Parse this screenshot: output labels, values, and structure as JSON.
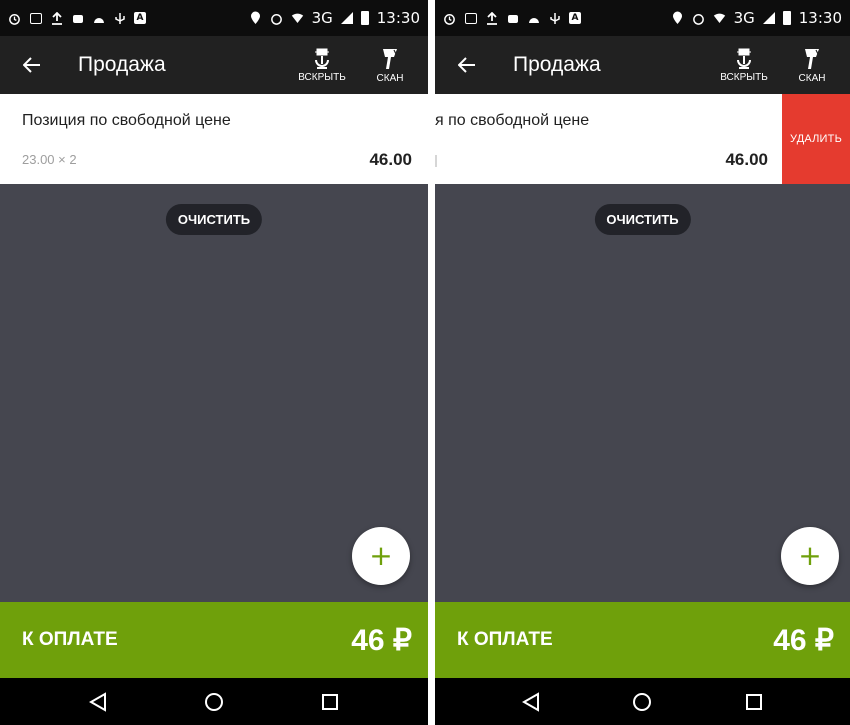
{
  "colors": {
    "status_bar": "#0d0d0d",
    "toolbar": "#212121",
    "content_bg": "#45464f",
    "accent_green": "#6fa00b",
    "delete_red": "#e53b2f"
  },
  "screens": [
    {
      "status": {
        "time": "13:30",
        "network": "3G"
      },
      "toolbar": {
        "title": "Продажа",
        "open_label": "ВСКРЫТЬ",
        "scan_label": "СКАН"
      },
      "item": {
        "name": "Позиция по свободной цене",
        "qty": "23.00 × 2",
        "total": "46.00"
      },
      "clear_label": "ОЧИСТИТЬ",
      "fab_label": "+",
      "pay": {
        "label": "К ОПЛАТЕ",
        "amount": "46 ₽"
      }
    },
    {
      "status": {
        "time": "13:30",
        "network": "3G"
      },
      "toolbar": {
        "title": "Продажа",
        "open_label": "ВСКРЫТЬ",
        "scan_label": "СКАН"
      },
      "item": {
        "name": "я по свободной цене",
        "total": "46.00",
        "delete_label": "УДАЛИТЬ"
      },
      "clear_label": "ОЧИСТИТЬ",
      "fab_label": "+",
      "pay": {
        "label": "К ОПЛАТЕ",
        "amount": "46 ₽"
      }
    }
  ],
  "icons": {
    "back": "arrow-left-icon",
    "open": "open-drawer-icon",
    "scan": "barcode-scanner-icon",
    "nav_back": "triangle-back-icon",
    "nav_home": "circle-home-icon",
    "nav_recent": "square-recent-icon"
  }
}
